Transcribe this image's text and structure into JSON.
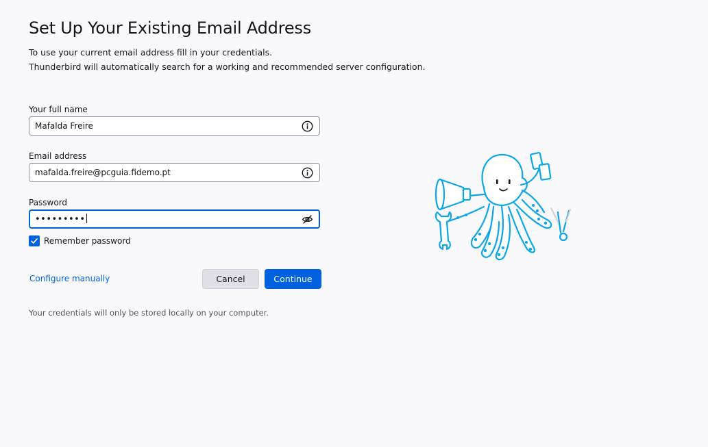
{
  "header": {
    "title": "Set Up Your Existing Email Address",
    "description_line1": "To use your current email address fill in your credentials.",
    "description_line2": "Thunderbird will automatically search for a working and recommended server configuration."
  },
  "form": {
    "full_name": {
      "label": "Your full name",
      "value": "Mafalda Freire",
      "icon": "info-icon"
    },
    "email": {
      "label": "Email address",
      "value": "mafalda.freire@pcguia.fidemo.pt",
      "icon": "info-icon"
    },
    "password": {
      "label": "Password",
      "value": "•••••••••",
      "icon": "eye-slash-icon",
      "focused": true
    },
    "remember": {
      "label": "Remember password",
      "checked": true
    }
  },
  "actions": {
    "configure_manually": "Configure manually",
    "cancel": "Cancel",
    "continue": "Continue"
  },
  "footer": {
    "note": "Your credentials will only be stored locally on your computer."
  },
  "colors": {
    "accent": "#0061e0",
    "background": "#f9f9fb",
    "mascot": "#0ba5ec"
  }
}
